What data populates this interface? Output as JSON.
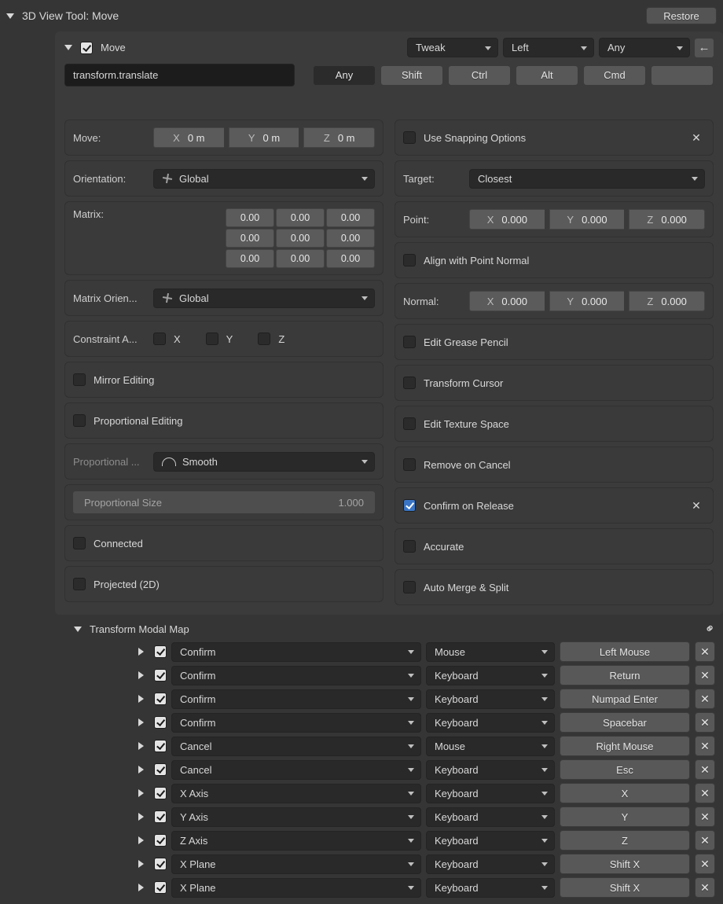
{
  "header": {
    "title": "3D View Tool: Move",
    "restore": "Restore"
  },
  "tool": {
    "name": "Move",
    "checked": true,
    "mode": "Tweak",
    "hand": "Left",
    "any": "Any",
    "identifier": "transform.translate",
    "modifiers": [
      "Any",
      "Shift",
      "Ctrl",
      "Alt",
      "Cmd"
    ]
  },
  "left": {
    "move": {
      "label": "Move:",
      "x": {
        "axis": "X",
        "value": "0 m"
      },
      "y": {
        "axis": "Y",
        "value": "0 m"
      },
      "z": {
        "axis": "Z",
        "value": "0 m"
      }
    },
    "orientation": {
      "label": "Orientation:",
      "value": "Global"
    },
    "matrix": {
      "label": "Matrix:",
      "rows": [
        [
          "0.00",
          "0.00",
          "0.00"
        ],
        [
          "0.00",
          "0.00",
          "0.00"
        ],
        [
          "0.00",
          "0.00",
          "0.00"
        ]
      ]
    },
    "matrix_orien": {
      "label": "Matrix Orien...",
      "value": "Global"
    },
    "constraint": {
      "label": "Constraint A...",
      "x": "X",
      "y": "Y",
      "z": "Z"
    },
    "mirror": "Mirror Editing",
    "proportional_editing": "Proportional Editing",
    "proportional_falloff": {
      "label": "Proportional ...",
      "value": "Smooth"
    },
    "proportional_size": {
      "label": "Proportional Size",
      "value": "1.000"
    },
    "connected": "Connected",
    "projected": "Projected (2D)"
  },
  "right": {
    "snapping": "Use Snapping Options",
    "target": {
      "label": "Target:",
      "value": "Closest"
    },
    "point": {
      "label": "Point:",
      "x": {
        "axis": "X",
        "value": "0.000"
      },
      "y": {
        "axis": "Y",
        "value": "0.000"
      },
      "z": {
        "axis": "Z",
        "value": "0.000"
      }
    },
    "align_point_normal": "Align with Point Normal",
    "normal": {
      "label": "Normal:",
      "x": {
        "axis": "X",
        "value": "0.000"
      },
      "y": {
        "axis": "Y",
        "value": "0.000"
      },
      "z": {
        "axis": "Z",
        "value": "0.000"
      }
    },
    "edit_gp": "Edit Grease Pencil",
    "transform_cursor": "Transform Cursor",
    "edit_tex": "Edit Texture Space",
    "remove_on_cancel": "Remove on Cancel",
    "confirm_on_release": "Confirm on Release",
    "accurate": "Accurate",
    "auto_merge": "Auto Merge & Split"
  },
  "modal": {
    "title": "Transform Modal Map",
    "rows": [
      {
        "action": "Confirm",
        "device": "Mouse",
        "key": "Left Mouse"
      },
      {
        "action": "Confirm",
        "device": "Keyboard",
        "key": "Return"
      },
      {
        "action": "Confirm",
        "device": "Keyboard",
        "key": "Numpad Enter"
      },
      {
        "action": "Confirm",
        "device": "Keyboard",
        "key": "Spacebar"
      },
      {
        "action": "Cancel",
        "device": "Mouse",
        "key": "Right Mouse"
      },
      {
        "action": "Cancel",
        "device": "Keyboard",
        "key": "Esc"
      },
      {
        "action": "X Axis",
        "device": "Keyboard",
        "key": "X"
      },
      {
        "action": "Y Axis",
        "device": "Keyboard",
        "key": "Y"
      },
      {
        "action": "Z Axis",
        "device": "Keyboard",
        "key": "Z"
      },
      {
        "action": "X Plane",
        "device": "Keyboard",
        "key": "Shift X"
      },
      {
        "action": "X Plane",
        "device": "Keyboard",
        "key": "Shift X"
      }
    ]
  }
}
